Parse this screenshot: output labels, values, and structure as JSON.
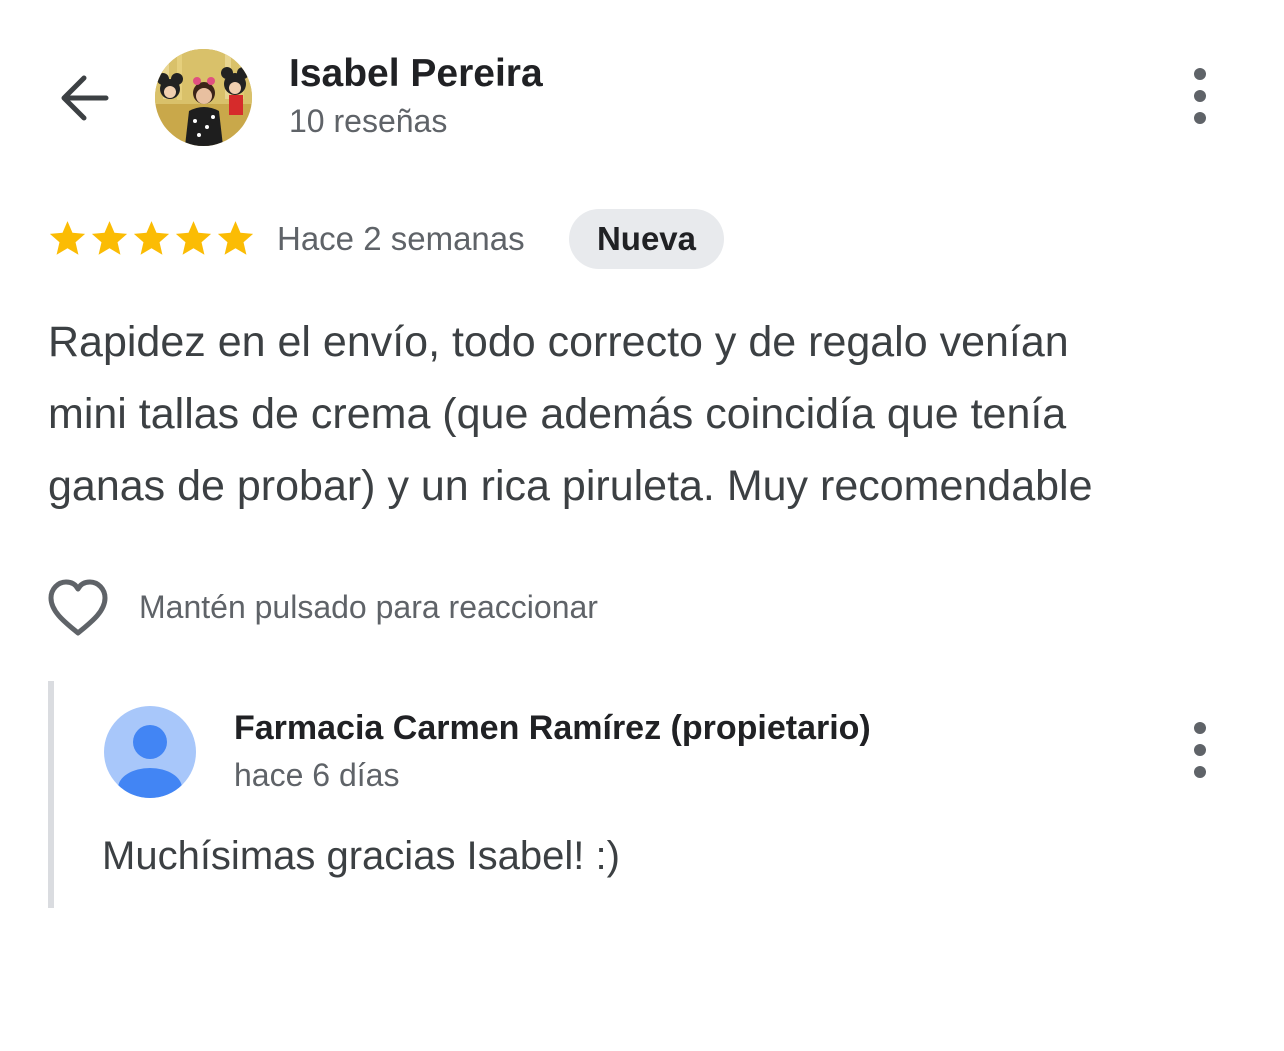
{
  "header": {
    "back_icon": "arrow-left-icon",
    "reviewer_name": "Isabel Pereira",
    "review_count": "10 reseñas",
    "more_icon": "more-vert-icon"
  },
  "review": {
    "rating": 5,
    "rating_max": 5,
    "star_color": "#fbbc04",
    "date": "Hace 2 semanas",
    "badge": "Nueva",
    "text_lines": [
      "Rapidez en el envío, todo correcto y de regalo venían",
      "mini tallas de crema (que además coincidía que tenía",
      "ganas de probar) y un rica piruleta. Muy recomendable"
    ]
  },
  "reaction": {
    "icon": "heart-outline-icon",
    "label": "Mantén pulsado para reaccionar"
  },
  "owner_reply": {
    "avatar_icon": "person-icon",
    "name": "Farmacia Carmen Ramírez (propietario)",
    "date": "hace 6 días",
    "text": "Muchísimas gracias Isabel! :)",
    "more_icon": "more-vert-icon"
  },
  "colors": {
    "avatar_blue_light": "#a8c7fa",
    "avatar_blue_dark": "#4285f4",
    "badge_bg": "#e8eaed"
  }
}
